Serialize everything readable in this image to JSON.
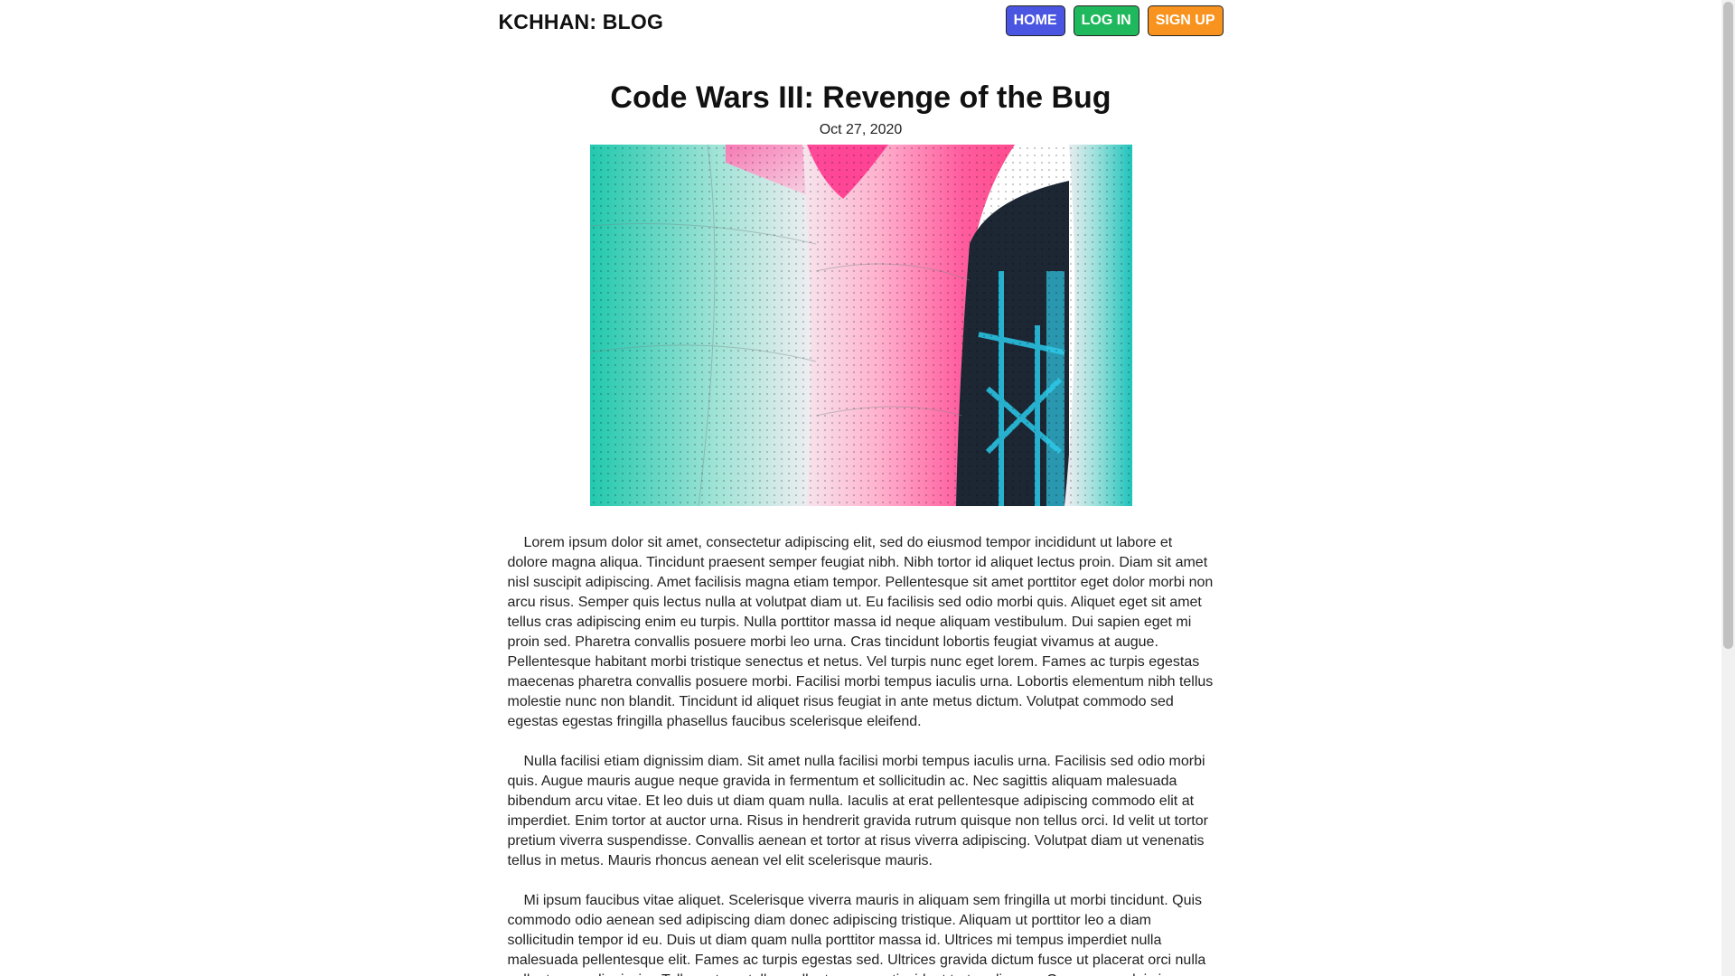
{
  "header": {
    "brand": "KCHHAN: BLOG",
    "nav": [
      {
        "label": "HOME",
        "color": "#4a56e2"
      },
      {
        "label": "LOG IN",
        "color": "#1fb85c"
      },
      {
        "label": "SIGN UP",
        "color": "#f7931e"
      }
    ]
  },
  "post": {
    "title": "Code Wars III: Revenge of the Bug",
    "date": "Oct 27, 2020",
    "paragraphs": [
      "Lorem ipsum dolor sit amet, consectetur adipiscing elit, sed do eiusmod tempor incididunt ut labore et dolore magna aliqua. Tincidunt praesent semper feugiat nibh. Nibh tortor id aliquet lectus proin. Diam sit amet nisl suscipit adipiscing. Amet facilisis magna etiam tempor. Pellentesque sit amet porttitor eget dolor morbi non arcu risus. Semper quis lectus nulla at volutpat diam ut. Eu facilisis sed odio morbi quis. Aliquet eget sit amet tellus cras adipiscing enim eu turpis. Nulla porttitor massa id neque aliquam vestibulum. Dui sapien eget mi proin sed. Pharetra convallis posuere morbi leo urna. Cras tincidunt lobortis feugiat vivamus at augue. Pellentesque habitant morbi tristique senectus et netus. Vel turpis nunc eget lorem. Fames ac turpis egestas maecenas pharetra convallis posuere morbi. Facilisi morbi tempus iaculis urna. Lobortis elementum nibh tellus molestie nunc non blandit. Tincidunt id aliquet risus feugiat in ante metus dictum. Volutpat commodo sed egestas egestas fringilla phasellus faucibus scelerisque eleifend.",
      "Nulla facilisi etiam dignissim diam. Sit amet nulla facilisi morbi tempus iaculis urna. Facilisis sed odio morbi quis. Augue mauris augue neque gravida in fermentum et sollicitudin ac. Nec sagittis aliquam malesuada bibendum arcu vitae. Et leo duis ut diam quam nulla. Iaculis at erat pellentesque adipiscing commodo elit at imperdiet. Enim tortor at auctor urna. Risus in hendrerit gravida rutrum quisque non tellus orci. Id velit ut tortor pretium viverra suspendisse. Convallis aenean et tortor at risus viverra adipiscing. Volutpat diam ut venenatis tellus in metus. Mauris rhoncus aenean vel elit scelerisque mauris.",
      "Mi ipsum faucibus vitae aliquet. Scelerisque viverra mauris in aliquam sem fringilla ut morbi tincidunt. Quis commodo odio aenean sed adipiscing diam donec adipiscing tristique. Aliquam ut porttitor leo a diam sollicitudin tempor id eu. Duis ut diam quam nulla porttitor massa id. Ultrices mi tempus imperdiet nulla malesuada pellentesque elit. Fames ac turpis egestas sed. Ultrices gravida dictum fusce ut placerat orci nulla pellentesque dignissim. Tellus rutrum tellus pellentesque eu tincidunt tortor aliquam. Ornare arcu dui vivamus"
    ]
  },
  "colors": {
    "hero_teal": "#23c9b0",
    "hero_pink": "#ff4f9a",
    "hero_white": "#f3eef2",
    "hero_dark": "#1d2a36",
    "hero_cyan": "#1fb6d6"
  }
}
